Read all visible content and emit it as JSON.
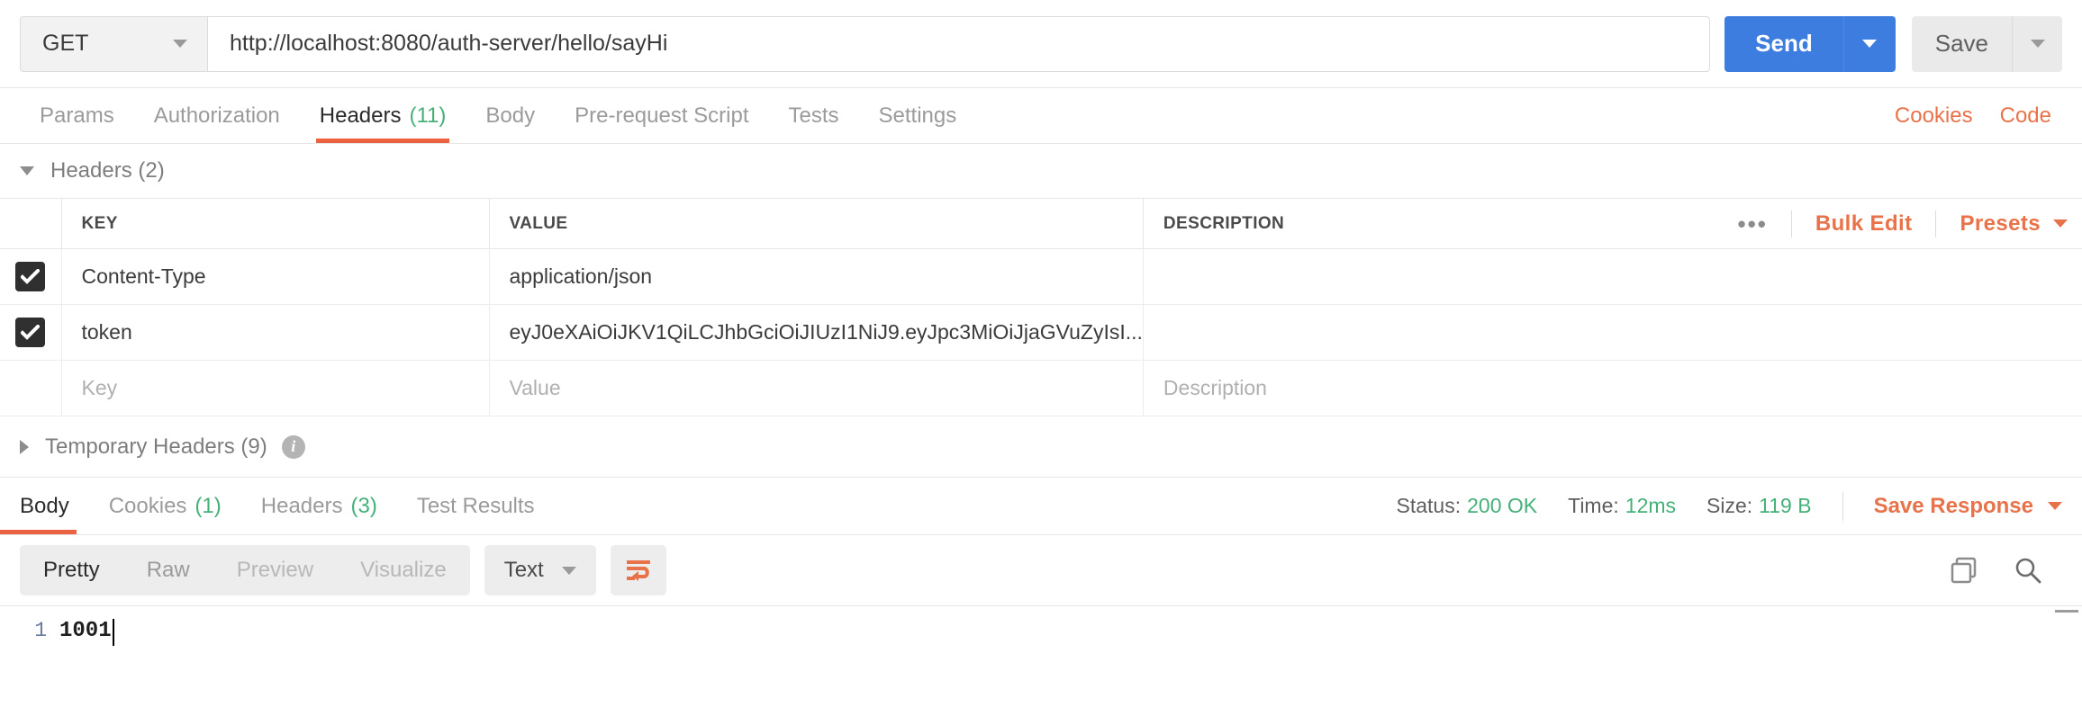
{
  "request": {
    "method": "GET",
    "url": "http://localhost:8080/auth-server/hello/sayHi",
    "send_label": "Send",
    "save_label": "Save",
    "tabs": [
      {
        "label": "Params",
        "count": ""
      },
      {
        "label": "Authorization",
        "count": ""
      },
      {
        "label": "Headers",
        "count": "(11)"
      },
      {
        "label": "Body",
        "count": ""
      },
      {
        "label": "Pre-request Script",
        "count": ""
      },
      {
        "label": "Tests",
        "count": ""
      },
      {
        "label": "Settings",
        "count": ""
      }
    ],
    "right_links": [
      {
        "label": "Cookies"
      },
      {
        "label": "Code"
      }
    ]
  },
  "headers_section": {
    "title": "Headers (2)",
    "columns": {
      "key": "KEY",
      "value": "VALUE",
      "description": "DESCRIPTION"
    },
    "tools": {
      "more": "•••",
      "bulk_edit": "Bulk Edit",
      "presets": "Presets"
    },
    "rows": [
      {
        "checked": true,
        "key": "Content-Type",
        "value": "application/json",
        "description": ""
      },
      {
        "checked": true,
        "key": "token",
        "value": "eyJ0eXAiOiJKV1QiLCJhbGciOiJIUzI1NiJ9.eyJpc3MiOiJjaGVuZyIsI...",
        "description": ""
      }
    ],
    "placeholder_row": {
      "key": "Key",
      "value": "Value",
      "description": "Description"
    },
    "temporary_headers": {
      "label": "Temporary Headers (9)",
      "info": "i"
    }
  },
  "response": {
    "tabs": [
      {
        "label": "Body",
        "count": ""
      },
      {
        "label": "Cookies",
        "count": "(1)"
      },
      {
        "label": "Headers",
        "count": "(3)"
      },
      {
        "label": "Test Results",
        "count": ""
      }
    ],
    "meta": {
      "status_label": "Status:",
      "status_value": "200 OK",
      "time_label": "Time:",
      "time_value": "12ms",
      "size_label": "Size:",
      "size_value": "119 B"
    },
    "save_response": "Save Response",
    "view_modes": [
      {
        "label": "Pretty",
        "state": "active"
      },
      {
        "label": "Raw",
        "state": "normal"
      },
      {
        "label": "Preview",
        "state": "disabled"
      },
      {
        "label": "Visualize",
        "state": "disabled"
      }
    ],
    "format": "Text",
    "body": {
      "line_number": "1",
      "content": "1001"
    }
  },
  "colors": {
    "accent_orange": "#eb6240",
    "link_orange": "#e8734a",
    "send_blue": "#3d7de0",
    "count_green": "#45b07a"
  }
}
